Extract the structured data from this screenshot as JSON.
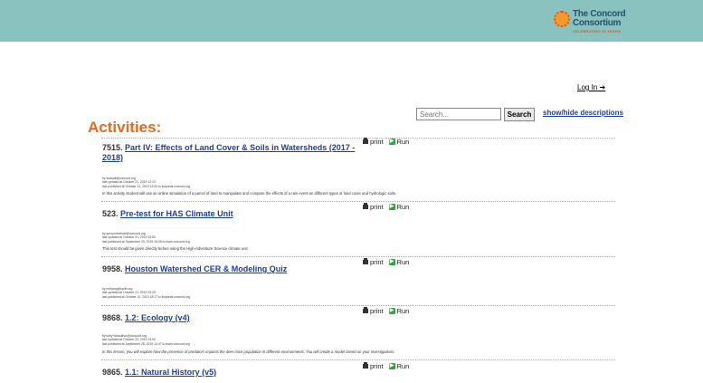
{
  "brand": {
    "logo_line1": "The Concord",
    "logo_line2": "Consortium",
    "logo_tagline": "CELEBRATING 25 YEARS"
  },
  "nav": {
    "login_label": "Log In"
  },
  "search": {
    "placeholder": "Search...",
    "button_label": "Search"
  },
  "show_hide_label": "show/hide descriptions",
  "page_title": "Activities:",
  "actions": {
    "print_label": "print",
    "run_label": "Run"
  },
  "activities": [
    {
      "number": "7515.",
      "title": "Part IV: Effects of Land Cover & Soils in Watersheds (2017 - 2018)",
      "author": "by sstaudt@concord.org",
      "updated": "last updated at October 21, 2019 12:10",
      "published": "last published at October 21, 2019 12:06 to lisiportal.concord.org",
      "description": "In this activity student will use an online simulation of a parcel of land to manipulate and compare the effects of a rain event on different types of land cover and hydrologic soils."
    },
    {
      "number": "523.",
      "title": "Pre-test for HAS Climate Unit",
      "author": "by spruputneinski@concord.org",
      "updated": "last updated at October 21, 2019 03:52",
      "published": "last published at September 23, 2019 15:05 to learn.concord.org",
      "description": "This test should be given directly before using the High-Adventure Science climate unit"
    },
    {
      "number": "9958.",
      "title": "Houston Watershed CER & Modeling Quiz",
      "author": "by mzhang@sprfb.org",
      "updated": "last updated at October 21, 2019 03:29",
      "published": "last published at October 10, 2019 18:17 to lisiportal.concord.org",
      "description": ""
    },
    {
      "number": "9868.",
      "title": "1.2: Ecology (v4)",
      "author": "by kiley+ldnauthor@concord.org",
      "updated": "last updated at October 20, 2019 23:00",
      "published": "last published at September 28, 2019 13:47 to learn.concord.org",
      "description": "In this lesson, you will explore how the presence of predators impacts the deer mice population in different environments. You will create a model based on your investigations."
    },
    {
      "number": "9865.",
      "title": "1.1: Natural History (v5)",
      "author": "",
      "updated": "",
      "published": "",
      "description": ""
    }
  ]
}
